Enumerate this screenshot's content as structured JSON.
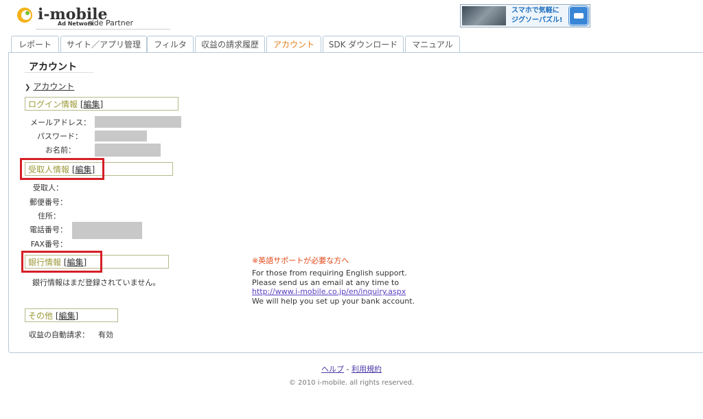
{
  "header": {
    "logo_text": "i-mobile",
    "logo_sub": "Ad Network",
    "logo_partner": "side Partner",
    "banner_text_line1": "スマホで気軽に",
    "banner_text_line2": "ジグソーパズル!"
  },
  "tabs": [
    {
      "label": "レポート",
      "active": false
    },
    {
      "label": "サイト／アプリ管理",
      "active": false
    },
    {
      "label": "フィルタ",
      "active": false
    },
    {
      "label": "収益の請求履歴",
      "active": false
    },
    {
      "label": "アカウント",
      "active": true
    },
    {
      "label": "SDK ダウンロード",
      "active": false
    },
    {
      "label": "マニュアル",
      "active": false
    }
  ],
  "page": {
    "title": "アカウント",
    "breadcrumb": "アカウント"
  },
  "sections": {
    "login": {
      "title": "ログイン情報",
      "edit": "[編集]",
      "fields": {
        "email": "メールアドレス：",
        "password": "パスワード：",
        "name": "お名前："
      }
    },
    "payee": {
      "title": "受取人情報",
      "edit": "[編集]",
      "fields": {
        "payee": "受取人：",
        "postal": "郵便番号：",
        "address": "住所：",
        "phone": "電話番号：",
        "fax": "FAX番号："
      }
    },
    "bank": {
      "title": "銀行情報",
      "edit": "[編集]",
      "message": "銀行情報はまだ登録されていません。"
    },
    "other": {
      "title": "その他",
      "edit": "[編集]",
      "auto_claim_label": "収益の自動請求：",
      "auto_claim_value": "有効"
    }
  },
  "english_support": {
    "title": "※英語サポートが必要な方へ",
    "line1": "For those from requiring English support.",
    "line2": "Please send us an email at any time to",
    "link": "http://www.i-mobile.co.jp/en/inquiry.aspx",
    "line3": "We will help you set up your bank account."
  },
  "footer": {
    "help": "ヘルプ",
    "separator": "-",
    "terms": "利用規約",
    "copyright": "© 2010 i-mobile. all rights reserved."
  },
  "colors": {
    "accent_tab": "#e07b1a",
    "highlight_box": "#d51f26",
    "section_title": "#9c9a3a"
  }
}
